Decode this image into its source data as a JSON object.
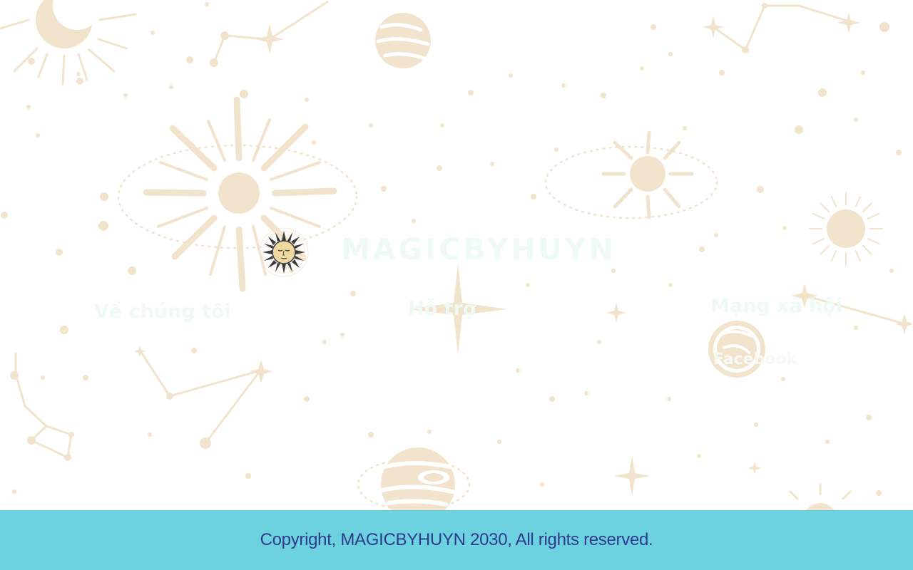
{
  "brand": {
    "name": "MAGICBYHUYN",
    "logo_icon": "sun-face-icon"
  },
  "columns": {
    "about": {
      "title": "Về chúng tôi"
    },
    "contact": {
      "title": "Hỗ trợ"
    },
    "social": {
      "title": "Mạng xã hội",
      "links": [
        "Facebook"
      ]
    }
  },
  "footer": {
    "copyright": "Copyright, MAGICBYHUYN 2030, All rights reserved."
  },
  "colors": {
    "background": "#ffffff",
    "decor": "#f2e4cc",
    "footer_bg": "#6cd2df",
    "footer_text": "#2e3a8c",
    "faint_text": "#eefaf3"
  }
}
